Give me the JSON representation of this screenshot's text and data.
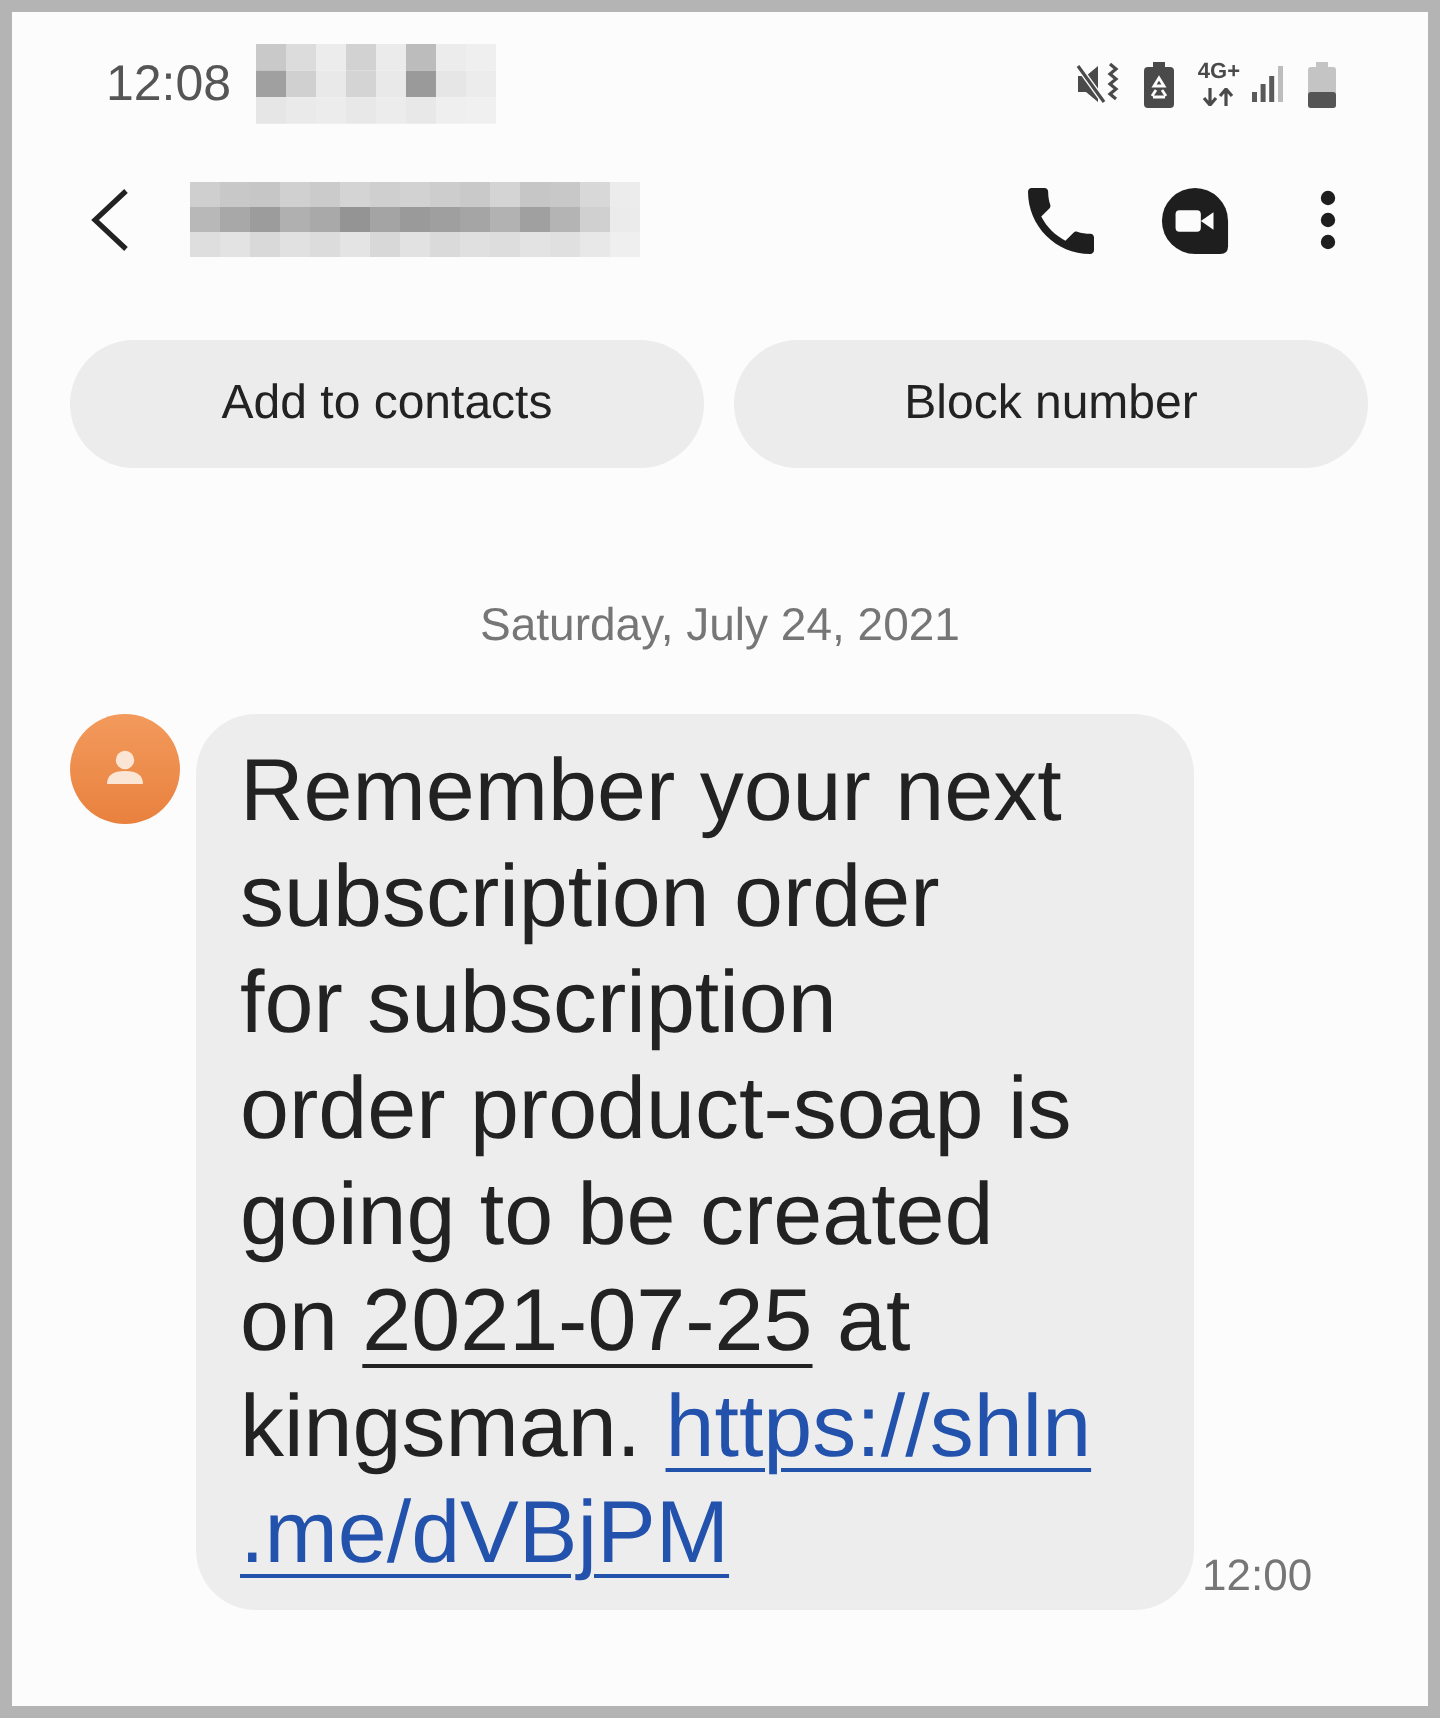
{
  "status_bar": {
    "time": "12:08",
    "network": "4G+"
  },
  "actions": [
    "Add to contacts",
    "Block number"
  ],
  "conversation": {
    "date": "Saturday, July 24, 2021",
    "messages": [
      {
        "segments": [
          {
            "kind": "text",
            "text": "Remember your next\nsubscription order\nfor subscription\norder product-soap is\ngoing to be created\non "
          },
          {
            "kind": "date",
            "text": "2021-07-25"
          },
          {
            "kind": "text",
            "text": " at\nkingsman. "
          },
          {
            "kind": "link",
            "text": "https://shln"
          },
          {
            "kind": "link",
            "text": ".me/dVBjPM"
          }
        ],
        "time": "12:00"
      }
    ]
  }
}
